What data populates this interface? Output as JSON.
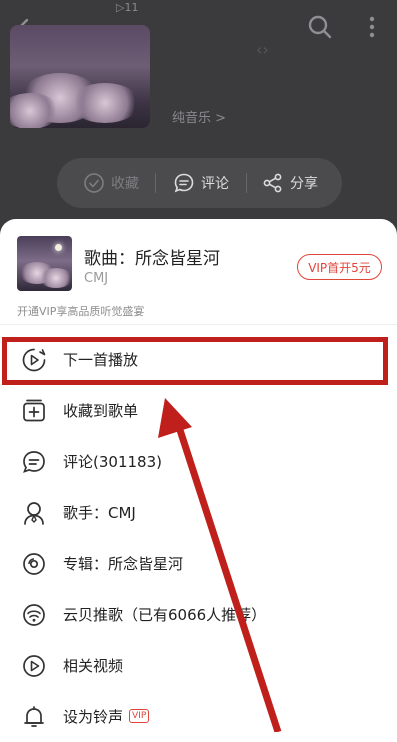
{
  "background": {
    "play_count": "▷11",
    "genre_tag": "纯音乐 >",
    "actions": {
      "favorite_label": "收藏",
      "comment_label": "评论",
      "share_label": "分享"
    }
  },
  "song": {
    "title": "歌曲：所念皆星河",
    "artist": "CMJ",
    "vip_button": "VIP首开5元",
    "vip_promo": "开通VIP享高品质听觉盛宴"
  },
  "menu": [
    {
      "label": "下一首播放",
      "icon": "play-next-icon"
    },
    {
      "label": "收藏到歌单",
      "icon": "add-to-playlist-icon"
    },
    {
      "label": "评论(301183)",
      "icon": "comment-icon"
    },
    {
      "label": "歌手：CMJ",
      "icon": "artist-icon"
    },
    {
      "label": "专辑：所念皆星河",
      "icon": "album-icon"
    },
    {
      "label": "云贝推歌（已有6066人推荐）",
      "icon": "cloud-coin-recommend-icon"
    },
    {
      "label": "相关视频",
      "icon": "video-icon"
    },
    {
      "label": "设为铃声",
      "icon": "bell-icon",
      "tag": "VIP"
    }
  ],
  "colors": {
    "accent": "#e0453a",
    "annotation": "#c0201b"
  }
}
